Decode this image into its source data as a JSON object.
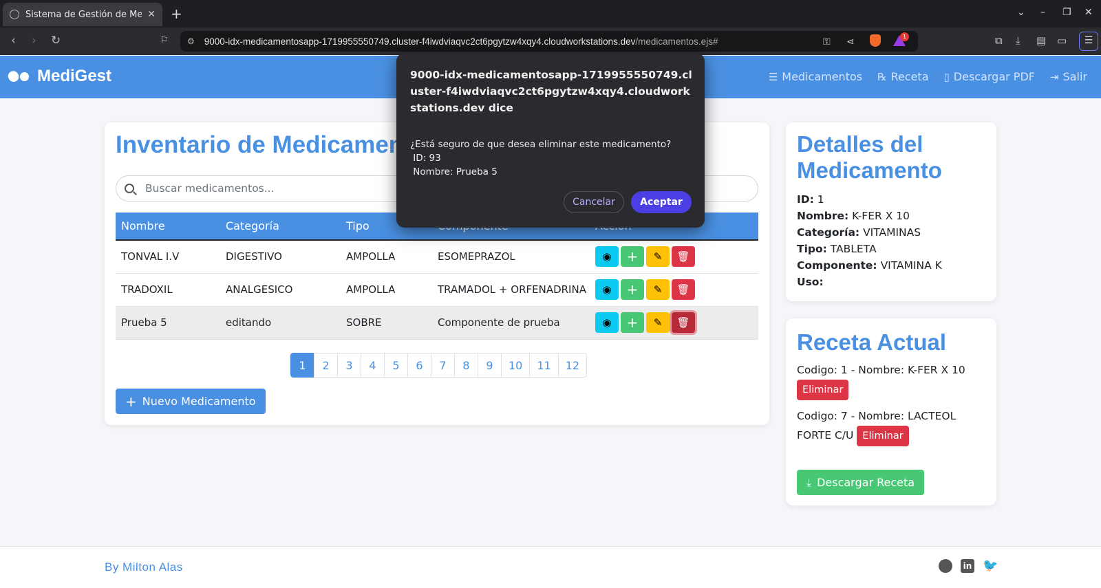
{
  "browser": {
    "tab_title": "Sistema de Gestión de Medic",
    "url_host": "9000-idx-medicamentosapp-1719955550749.cluster-f4iwdviaqvc2ct6pgytzw4xqy4.cloudworkstations.dev",
    "url_path": "/medicamentos.ejs#",
    "rewards_badge": "1"
  },
  "nav": {
    "brand": "MediGest",
    "links": [
      {
        "label": "Medicamentos",
        "icon": "list-icon"
      },
      {
        "label": "Receta",
        "icon": "rx-icon"
      },
      {
        "label": "Descargar PDF",
        "icon": "file-icon"
      },
      {
        "label": "Salir",
        "icon": "logout-icon"
      }
    ]
  },
  "inventory": {
    "title": "Inventario de Medicamentos",
    "search_placeholder": "Buscar medicamentos...",
    "columns": [
      "Nombre",
      "Categoría",
      "Tipo",
      "Componente",
      "Acción"
    ],
    "rows": [
      {
        "nombre": "TONVAL I.V",
        "categoria": "DIGESTIVO",
        "tipo": "AMPOLLA",
        "componente": "ESOMEPRAZOL"
      },
      {
        "nombre": "TRADOXIL",
        "categoria": "ANALGESICO",
        "tipo": "AMPOLLA",
        "componente": "TRAMADOL + ORFENADRINA"
      },
      {
        "nombre": "Prueba 5",
        "categoria": "editando",
        "tipo": "SOBRE",
        "componente": "Componente de prueba"
      }
    ],
    "pages": [
      "1",
      "2",
      "3",
      "4",
      "5",
      "6",
      "7",
      "8",
      "9",
      "10",
      "11",
      "12"
    ],
    "current_page": "1",
    "new_button": "Nuevo Medicamento"
  },
  "details": {
    "title": "Detalles del Medicamento",
    "fields": [
      {
        "label": "ID:",
        "value": "1"
      },
      {
        "label": "Nombre:",
        "value": "K-FER X 10"
      },
      {
        "label": "Categoría:",
        "value": "VITAMINAS"
      },
      {
        "label": "Tipo:",
        "value": "TABLETA"
      },
      {
        "label": "Componente:",
        "value": "VITAMINA K"
      },
      {
        "label": "Uso:",
        "value": ""
      }
    ]
  },
  "recipe": {
    "title": "Receta Actual",
    "items": [
      {
        "text": "Codigo: 1 - Nombre: K-FER X 10",
        "action": "Eliminar"
      },
      {
        "text": "Codigo: 7 - Nombre: LACTEOL FORTE C/U",
        "action": "Eliminar"
      }
    ],
    "download_button": "Descargar Receta"
  },
  "footer": {
    "byline": "By Milton Alas"
  },
  "dialog": {
    "title": "9000-idx-medicamentosapp-1719955550749.cluster-f4iwdviaqvc2ct6pgytzw4xqy4.cloudworkstations.dev dice",
    "message_lines": [
      "¿Está seguro de que desea eliminar este medicamento?",
      " ID: 93",
      " Nombre: Prueba 5"
    ],
    "cancel": "Cancelar",
    "accept": "Aceptar"
  },
  "colors": {
    "primary": "#4a90e2",
    "danger": "#dc3545",
    "success": "#48c774",
    "warning": "#ffc107",
    "info": "#0dcaf0",
    "dialog_accept": "#4b3fe4"
  }
}
